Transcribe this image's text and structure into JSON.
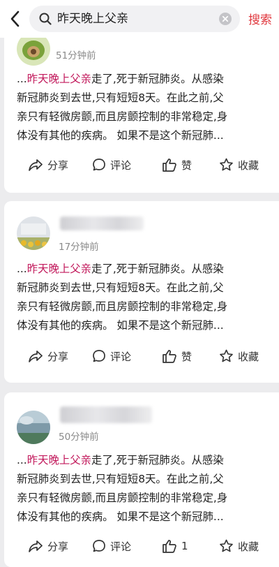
{
  "search": {
    "query": "昨天晚上父亲",
    "submit_label": "搜索"
  },
  "posts": [
    {
      "time": "51分钟前",
      "lines": [
        {
          "pre": "...",
          "highlight": "昨天晚上父亲",
          "rest": "走了,死于新冠肺炎。从感染"
        },
        {
          "pre": "",
          "highlight": "",
          "rest": "新冠肺炎到去世,只有短短8天。在此之前,父"
        },
        {
          "pre": "",
          "highlight": "",
          "rest": "亲只有轻微房颤,而且房颤控制的非常稳定,身"
        },
        {
          "pre": "",
          "highlight": "",
          "rest": "体没有其他的疾病。 如果不是这个新冠肺..."
        }
      ],
      "share_label": "分享",
      "comment_label": "评论",
      "like_label": "赞",
      "favorite_label": "收藏"
    },
    {
      "time": "17分钟前",
      "lines": [
        {
          "pre": "...",
          "highlight": "昨天晚上父亲",
          "rest": "走了,死于新冠肺炎。从感染"
        },
        {
          "pre": "",
          "highlight": "",
          "rest": "新冠肺炎到去世,只有短短8天。在此之前,父"
        },
        {
          "pre": "",
          "highlight": "",
          "rest": "亲只有轻微房颤,而且房颤控制的非常稳定,身"
        },
        {
          "pre": "",
          "highlight": "",
          "rest": "体没有其他的疾病。 如果不是这个新冠肺..."
        }
      ],
      "share_label": "分享",
      "comment_label": "评论",
      "like_label": "赞",
      "favorite_label": "收藏"
    },
    {
      "time": "50分钟前",
      "lines": [
        {
          "pre": "...",
          "highlight": "昨天晚上父亲",
          "rest": "走了,死于新冠肺炎。从感染"
        },
        {
          "pre": "",
          "highlight": "",
          "rest": "新冠肺炎到去世,只有短短8天。在此之前,父"
        },
        {
          "pre": "",
          "highlight": "",
          "rest": "亲只有轻微房颤,而且房颤控制的非常稳定,身"
        },
        {
          "pre": "",
          "highlight": "",
          "rest": "体没有其他的疾病。 如果不是这个新冠肺..."
        }
      ],
      "share_label": "分享",
      "comment_label": "评论",
      "like_label": "1",
      "favorite_label": "收藏"
    }
  ],
  "colors": {
    "accent": "#e0383e",
    "highlight": "#c2185b",
    "meta": "#8a8a8a",
    "background": "#ececee"
  },
  "icons": [
    "back-arrow-icon",
    "search-icon",
    "clear-icon",
    "share-icon",
    "comment-icon",
    "like-icon",
    "favorite-star-icon"
  ]
}
